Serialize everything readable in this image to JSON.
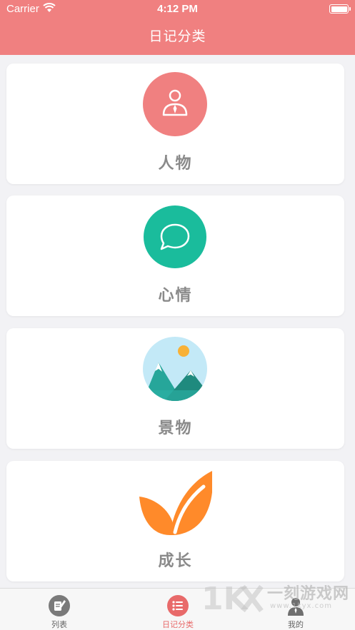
{
  "status_bar": {
    "carrier": "Carrier",
    "time": "4:12 PM"
  },
  "nav": {
    "title": "日记分类"
  },
  "categories": [
    {
      "label": "人物",
      "icon": "person-icon",
      "color": "#f08080"
    },
    {
      "label": "心情",
      "icon": "chat-bubble-icon",
      "color": "#1abc9c"
    },
    {
      "label": "景物",
      "icon": "mountain-landscape-icon",
      "color": "#c3e9f7"
    },
    {
      "label": "成长",
      "icon": "leaf-icon",
      "color": "#ff8a2a"
    }
  ],
  "tabs": [
    {
      "label": "列表",
      "icon": "pen-list-icon",
      "active": false
    },
    {
      "label": "日记分类",
      "icon": "list-icon",
      "active": true
    },
    {
      "label": "我的",
      "icon": "user-icon",
      "active": false
    }
  ],
  "watermark": {
    "text": "一刻游戏网",
    "sub": "www.1kyx.com"
  },
  "colors": {
    "accent": "#f08080",
    "active_tab": "#e86a6a",
    "label_gray": "#8a8a8a"
  }
}
